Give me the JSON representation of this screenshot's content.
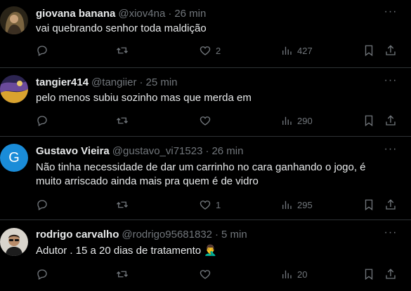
{
  "tweets": [
    {
      "name": "giovana banana",
      "handle": "@xiov4na",
      "time": "26 min",
      "text": "vai quebrando senhor toda maldição",
      "likes": "2",
      "views": "427",
      "avatar_color": "#6b5a3a"
    },
    {
      "name": "tangier414",
      "handle": "@tangiier",
      "time": "25 min",
      "text": "pelo menos subiu sozinho mas que merda em",
      "likes": "",
      "views": "290",
      "avatar_color": "#4a3a6a"
    },
    {
      "name": "Gustavo Vieira",
      "handle": "@gustavo_vi71523",
      "time": "26 min",
      "text": "Não tinha necessidade de dar um carrinho no cara ganhando o jogo, é muito arriscado ainda mais pra quem é de vidro",
      "likes": "1",
      "views": "295",
      "avatar_letter": "G",
      "avatar_color": "#1a8cd8"
    },
    {
      "name": "rodrigo carvalho",
      "handle": "@rodrigo95681832",
      "time": "5 min",
      "text": "Adutor . 15 a 20 dias de tratamento 🤦‍♂️",
      "likes": "",
      "views": "20",
      "avatar_color": "#c9c6c0"
    }
  ],
  "separator": "·",
  "icons": [
    "reply-icon",
    "retweet-icon",
    "like-icon",
    "views-icon",
    "bookmark-icon",
    "share-icon",
    "more-icon"
  ]
}
